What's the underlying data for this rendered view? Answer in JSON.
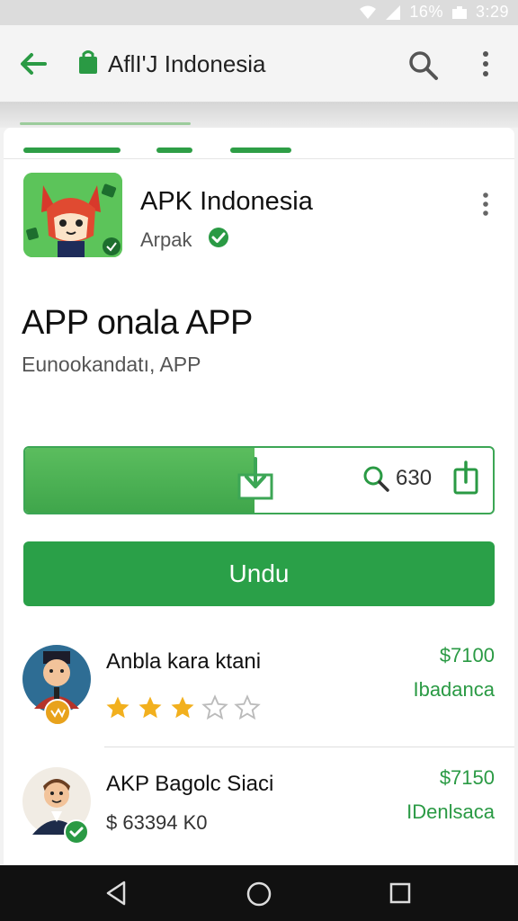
{
  "status_bar": {
    "battery": "16%",
    "time": "3:29"
  },
  "toolbar": {
    "title": "AflI'J Indonesia",
    "back_icon": "arrow-left-icon",
    "search_icon": "search-icon",
    "menu_icon": "more-vertical-icon"
  },
  "app": {
    "name": "APK Indonesia",
    "developer": "Arpak",
    "verified_icon": "check-circle-icon",
    "headline": "APP onala APP",
    "subtitle": "Eunookandatı, APP"
  },
  "progress": {
    "fraction": 0.49,
    "zoom_value": "630",
    "download_icon": "download-icon",
    "zoom_icon": "zoom-icon",
    "share_icon": "share-icon"
  },
  "install_button": {
    "label": "Undu"
  },
  "list": [
    {
      "title": "Anbla kara ktani",
      "price": "$7100",
      "region": "Ibadanca",
      "rating": 3,
      "max_rating": 5
    },
    {
      "title": "AKP Bagolc Siaci",
      "price": "$7150",
      "region": "IDenlsaca",
      "subtitle": "$ 63394 K0"
    }
  ],
  "colors": {
    "accent": "#2aa048",
    "price": "#2a9a44",
    "navbar": "#111111"
  }
}
